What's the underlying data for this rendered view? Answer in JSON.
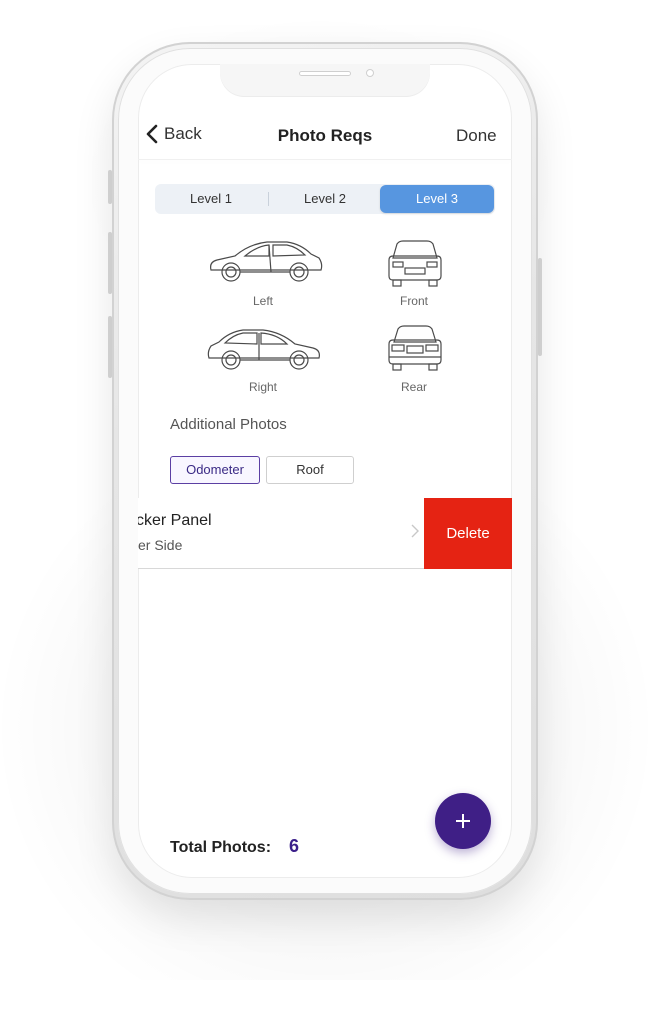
{
  "header": {
    "back_label": "Back",
    "title": "Photo Reqs",
    "done_label": "Done"
  },
  "levels": {
    "items": [
      "Level 1",
      "Level 2",
      "Level 3"
    ],
    "selected": "Level 3"
  },
  "car_views": {
    "left": "Left",
    "front": "Front",
    "right": "Right",
    "rear": "Rear"
  },
  "additional": {
    "title": "Additional Photos",
    "chips": [
      "Odometer",
      "Roof"
    ],
    "selected_chip": "Odometer"
  },
  "list_row": {
    "title": "cker Panel",
    "subtitle": "er Side",
    "delete_label": "Delete"
  },
  "footer": {
    "total_label": "Total Photos:",
    "total_value": "6",
    "fab_icon": "plus-icon"
  },
  "colors": {
    "accent_blue": "#5796e0",
    "brand_purple": "#3f1f86",
    "delete_red": "#e52313"
  }
}
